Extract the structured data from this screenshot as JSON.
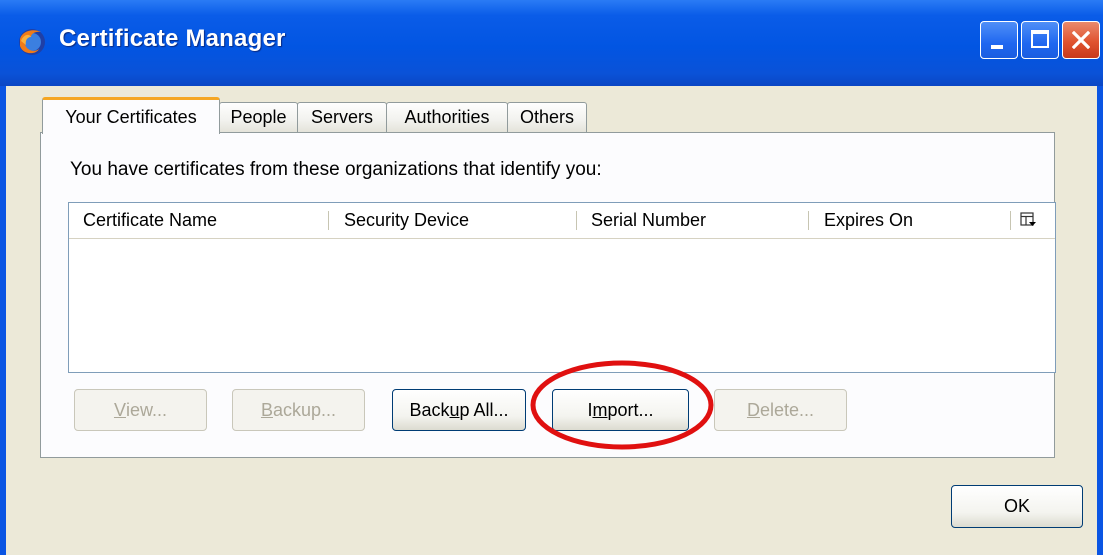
{
  "window": {
    "title": "Certificate Manager",
    "app_icon": "firefox-icon",
    "controls": {
      "minimize": "minimize-icon",
      "maximize": "maximize-icon",
      "close": "close-icon"
    }
  },
  "tabs": [
    {
      "label": "Your Certificates",
      "active": true
    },
    {
      "label": "People",
      "active": false
    },
    {
      "label": "Servers",
      "active": false
    },
    {
      "label": "Authorities",
      "active": false
    },
    {
      "label": "Others",
      "active": false
    }
  ],
  "panel": {
    "intro": "You have certificates from these organizations that identify you:",
    "columns": [
      "Certificate Name",
      "Security Device",
      "Serial Number",
      "Expires On"
    ],
    "column_picker_icon": "column-picker-icon",
    "rows": []
  },
  "buttons": {
    "view": {
      "before": "",
      "accel": "V",
      "after": "iew...",
      "enabled": false
    },
    "backup": {
      "before": "",
      "accel": "B",
      "after": "ackup...",
      "enabled": false
    },
    "backup_all": {
      "before": "Back",
      "accel": "u",
      "after": "p All...",
      "enabled": true
    },
    "import": {
      "before": "I",
      "accel": "m",
      "after": "port...",
      "enabled": true
    },
    "delete": {
      "before": "",
      "accel": "D",
      "after": "elete...",
      "enabled": false
    }
  },
  "ok_label": "OK",
  "colors": {
    "titlebar": "#0a55e3",
    "dialog_bg": "#ece9d8",
    "active_tab_accent": "#f5a623",
    "highlight_circle": "#e01010"
  }
}
